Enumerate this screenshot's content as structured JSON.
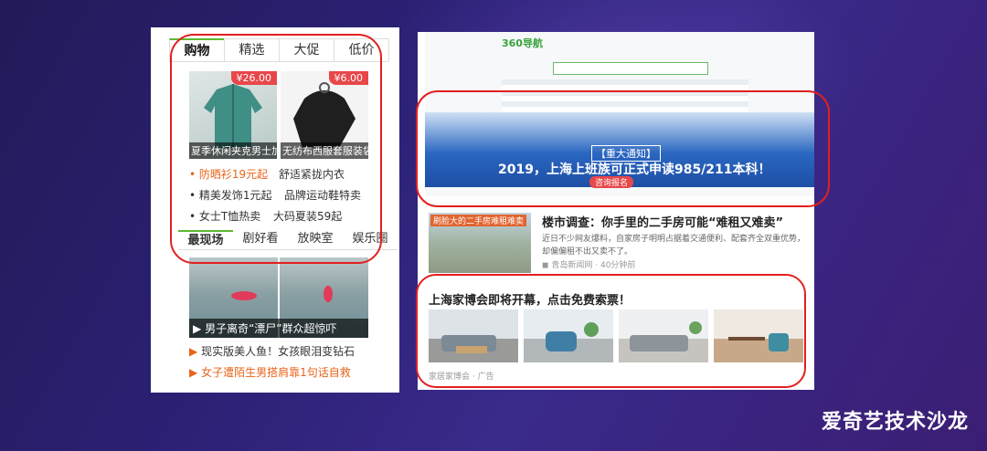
{
  "watermark": "爱奇艺技术沙龙",
  "left_panel": {
    "tabs": [
      "购物",
      "精选",
      "大促",
      "低价"
    ],
    "products": [
      {
        "price": "¥26.00",
        "title": "夏季休闲夹克男士加"
      },
      {
        "price": "¥6.00",
        "title": "无纺布西服套服装袋"
      }
    ],
    "promos": [
      {
        "text": "防晒衫19元起",
        "highlight": true
      },
      {
        "text": "舒适紧拢内衣",
        "highlight": false
      },
      {
        "text": "精美发饰1元起",
        "highlight": false
      },
      {
        "text": "品牌运动鞋特卖",
        "highlight": false
      },
      {
        "text": "女士T恤热卖",
        "highlight": false
      },
      {
        "text": "大码夏装59起",
        "highlight": false
      }
    ],
    "tabs2": [
      "最现场",
      "剧好看",
      "放映室",
      "娱乐圈"
    ],
    "video_caption": "男子离奇“漂尸”群众超惊吓",
    "news": [
      {
        "text": "现实版美人鱼！女孩眼泪变钻石",
        "color": "#333333"
      },
      {
        "text": "女子遭陌生男搭肩靠1句话自救",
        "color": "#e8641b"
      }
    ]
  },
  "right_panel": {
    "screenshot": {
      "logo": "360导航",
      "notice": "【重大通知】",
      "banner": "2019，上海上班族可正式申读985/211本科！",
      "button": "咨询报名"
    },
    "article": {
      "image_tag": "刷脸大的二手房难租难卖",
      "title": "楼市调查：你手里的二手房可能“难租又难卖”",
      "summary": "近日不少网友爆料，自家房子明明占据着交通便利、配套齐全双重优势，却偏偏租不出又卖不了。",
      "source": "青岛新闻网",
      "time": "40分钟前"
    },
    "ad": {
      "title": "上海家博会即将开幕，点击免费索票！",
      "source": "家居家博会",
      "label": "广告"
    }
  },
  "colors": {
    "accent_red": "#e31f1f",
    "price_red": "#e8474a",
    "promo_orange": "#e8641b",
    "tab_green": "#5fb832"
  }
}
